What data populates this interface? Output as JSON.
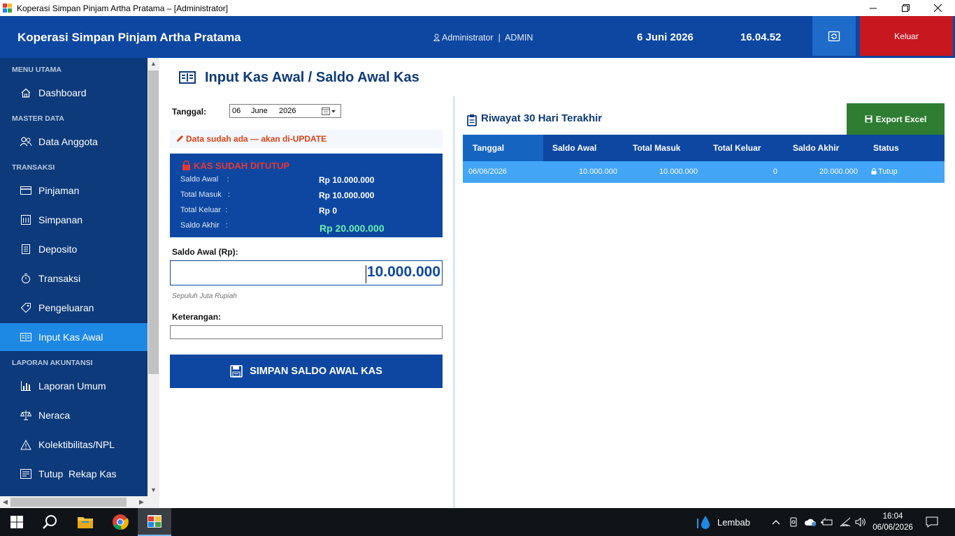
{
  "window": {
    "title": "Koperasi Simpan Pinjam Artha Pratama – [Administrator]"
  },
  "header": {
    "brand": "Koperasi Simpan Pinjam Artha Pratama",
    "user": "Administrator  |  ADMIN",
    "date": "6 Juni 2026",
    "time": "16.04.52",
    "logout_label": "Keluar"
  },
  "sidebar": {
    "sections": {
      "menu_utama": "MENU UTAMA",
      "master_data": "MASTER DATA",
      "transaksi": "TRANSAKSI",
      "laporan": "LAPORAN  AKUNTANSI"
    },
    "items": {
      "dashboard": "Dashboard",
      "data_anggota": "Data Anggota",
      "pinjaman": "Pinjaman",
      "simpanan": "Simpanan",
      "deposito": "Deposito",
      "transaksi": "Transaksi",
      "pengeluaran": "Pengeluaran",
      "input_kas_awal": "Input Kas Awal",
      "laporan_umum": "Laporan Umum",
      "neraca": "Neraca",
      "kolektibilitas": "Kolektibilitas/NPL",
      "tutup_rekap": "Tutup  Rekap Kas"
    }
  },
  "main": {
    "page_title": "Input Kas Awal / Saldo Awal Kas",
    "tanggal_label": "Tanggal:",
    "date_day": "06",
    "date_month": "June",
    "date_year": "2026",
    "warning": "Data sudah ada — akan di-UPDATE",
    "closed_box": {
      "header": "KAS SUDAH DITUTUP",
      "saldo_awal_label": "Saldo Awal    :",
      "saldo_awal_value": "Rp 10.000.000",
      "total_masuk_label": "Total Masuk   :",
      "total_masuk_value": "Rp 10.000.000",
      "total_keluar_label": "Total Keluar  :",
      "total_keluar_value": "Rp 0",
      "saldo_akhir_label": "Saldo Akhir   :",
      "saldo_akhir_value": "Rp 20.000.000"
    },
    "saldo_awal_field_label": "Saldo Awal (Rp):",
    "saldo_awal_input_value": "10.000.000",
    "terbilang": "Sepuluh Juta Rupiah",
    "keterangan_label": "Keterangan:",
    "keterangan_value": "",
    "save_button": "SIMPAN SALDO AWAL KAS"
  },
  "history": {
    "title": "Riwayat 30 Hari Terakhir",
    "export_label": "Export Excel",
    "columns": [
      "Tanggal",
      "Saldo Awal",
      "Total Masuk",
      "Total Keluar",
      "Saldo Akhir",
      "Status"
    ],
    "rows": [
      {
        "tanggal": "06/06/2026",
        "saldo_awal": "10.000.000",
        "total_masuk": "10.000.000",
        "total_keluar": "0",
        "saldo_akhir": "20.000.000",
        "status": "Tutup"
      }
    ]
  },
  "taskbar": {
    "weather": "Lembab",
    "clock_time": "16:04",
    "clock_date": "06/06/2026"
  },
  "colors": {
    "header_bg": "#0d47a1",
    "sidebar_bg": "#0d3a7a",
    "active_nav": "#1e88e5",
    "logout": "#c8171f",
    "export": "#2e7d32",
    "row_bg": "#42a5f5",
    "saldo_akhir_accent": "#69f0ae"
  }
}
